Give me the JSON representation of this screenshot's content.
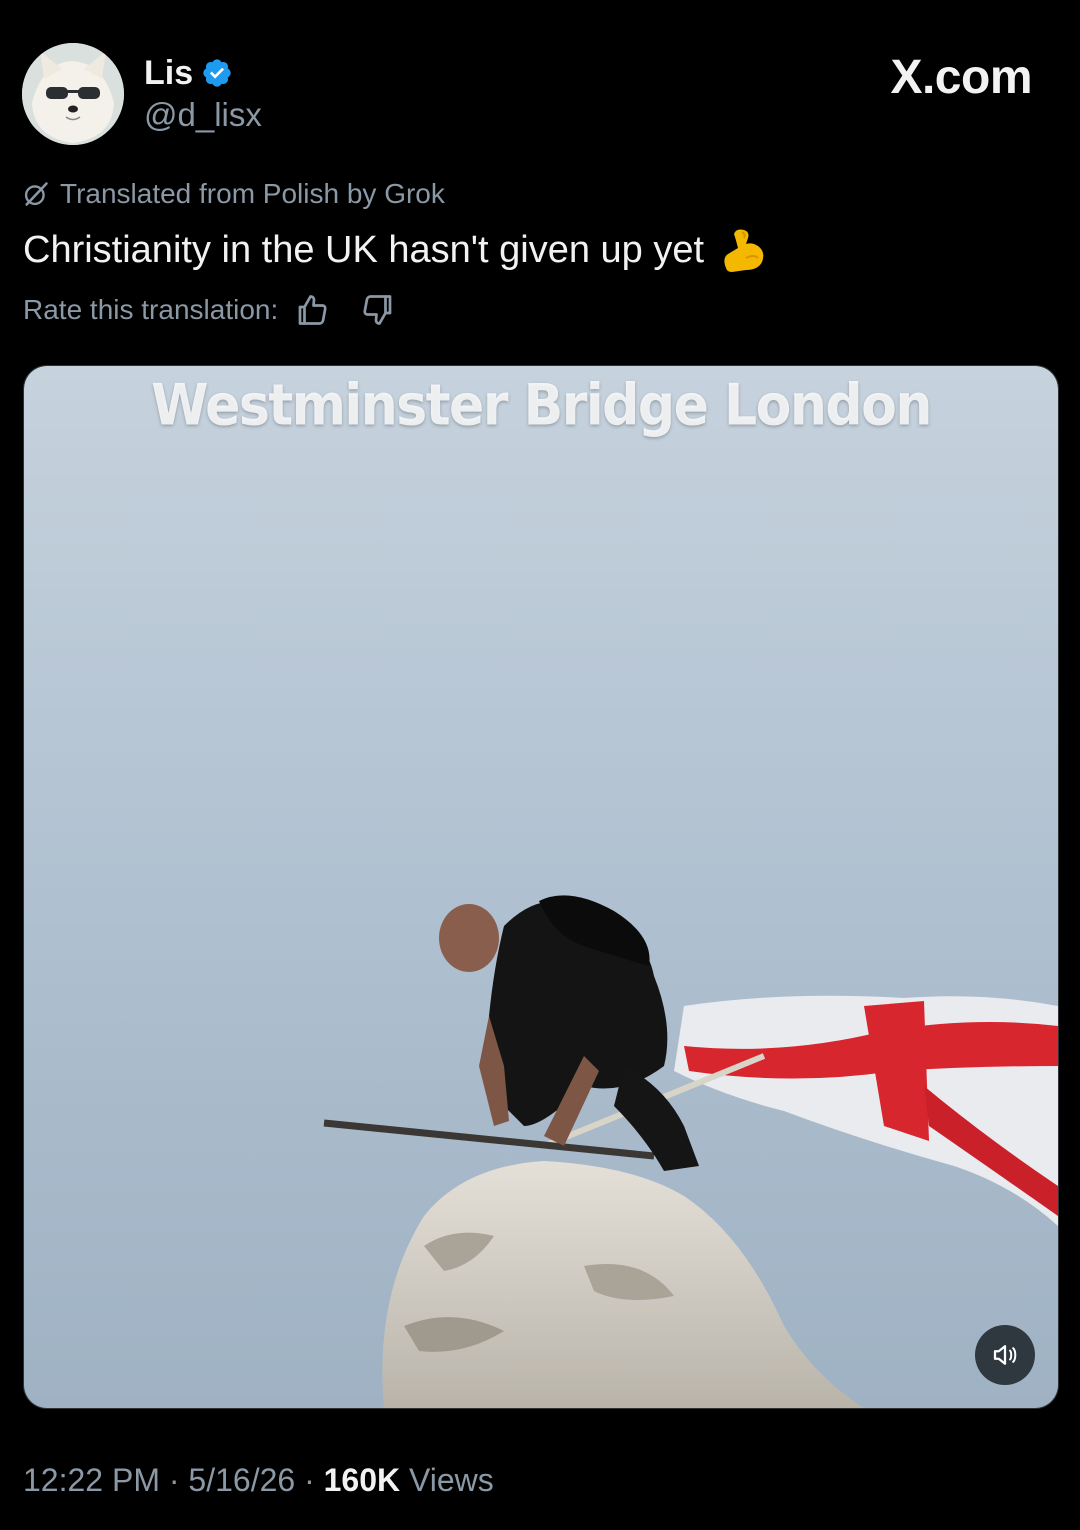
{
  "author": {
    "name": "Lis",
    "handle": "@d_lisx",
    "verified": true,
    "avatar_icon": "fox-with-sunglasses-avatar"
  },
  "brand": {
    "label": "X.com"
  },
  "translation": {
    "notice": "Translated from Polish by Grok",
    "rate_label": "Rate this translation:"
  },
  "post": {
    "text": "Christianity in the UK hasn't given up yet",
    "emoji": "flexed-biceps-emoji"
  },
  "media": {
    "caption": "Westminster Bridge London",
    "volume_icon": "volume-icon"
  },
  "meta": {
    "time": "12:22 PM",
    "date": "5/16/26",
    "views_count": "160K",
    "views_label": "Views",
    "separator": "·"
  },
  "colors": {
    "background": "#000000",
    "primary_text": "#e7e9ea",
    "secondary_text": "#8b98a5",
    "verified_blue": "#1d9bf0"
  }
}
